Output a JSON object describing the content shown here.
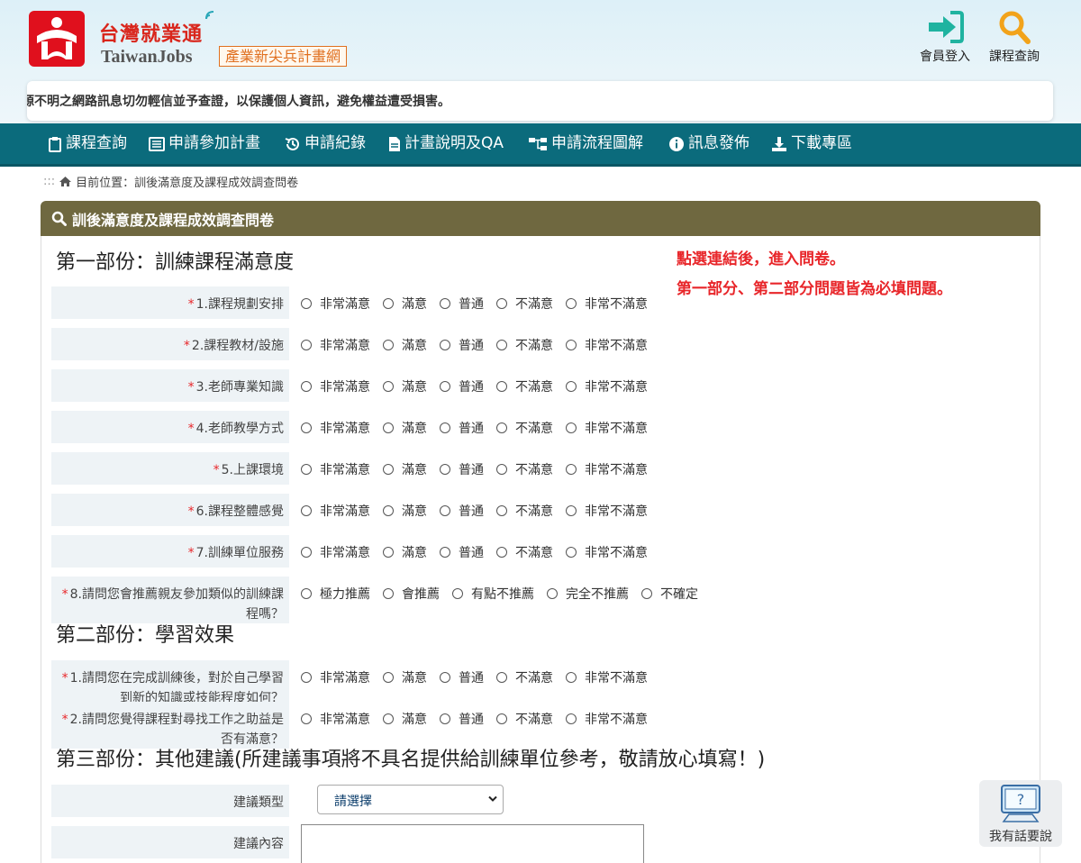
{
  "header": {
    "brand_cn": "台灣就業通",
    "brand_en": "TaiwanJobs",
    "brand_sub": "產業新尖兵計畫網",
    "login_label": "會員登入",
    "search_label": "課程查詢",
    "notice": "來源不明之網路訊息切勿輕信並予查證，以保護個人資訊，避免權益遭受損害。"
  },
  "nav": {
    "items": [
      "課程查詢",
      "申請參加計畫",
      "申請紀錄",
      "計畫說明及QA",
      "申請流程圖解",
      "訊息發佈",
      "下載專區"
    ]
  },
  "breadcrumb": {
    "prefix": ":::",
    "text": "目前位置：訓後滿意度及課程成效調查問卷"
  },
  "panel": {
    "title": "訓後滿意度及課程成效調查問卷"
  },
  "notes": {
    "line1": "點選連結後，進入問卷。",
    "line2": "第一部分、第二部分問題皆為必填問題。"
  },
  "part1": {
    "title": "第一部份：訓練課程滿意度",
    "options": [
      "非常滿意",
      "滿意",
      "普通",
      "不滿意",
      "非常不滿意"
    ],
    "questions": [
      "1.課程規劃安排",
      "2.課程教材/設施",
      "3.老師專業知識",
      "4.老師教學方式",
      "5.上課環境",
      "6.課程整體感覺",
      "7.訓練單位服務"
    ],
    "q8": "8.請問您會推薦親友參加類似的訓練課程嗎？",
    "q8_options": [
      "極力推薦",
      "會推薦",
      "有點不推薦",
      "完全不推薦",
      "不確定"
    ]
  },
  "part2": {
    "title": "第二部份：學習效果",
    "questions": [
      "1.請問您在完成訓練後，對於自己學習到新的知識或技能程度如何？",
      "2.請問您覺得課程對尋找工作之助益是否有滿意？"
    ]
  },
  "part3": {
    "title": "第三部份：其他建議(所建議事項將不具名提供給訓練單位參考，敬請放心填寫！)",
    "type_label": "建議類型",
    "type_value": "請選擇",
    "content_label": "建議內容"
  },
  "feedback": {
    "label": "我有話要說"
  },
  "colors": {
    "nav": "#0b6b7c",
    "panel_header": "#6f6840",
    "required": "#e8262a",
    "brand_red": "#e0101d"
  }
}
